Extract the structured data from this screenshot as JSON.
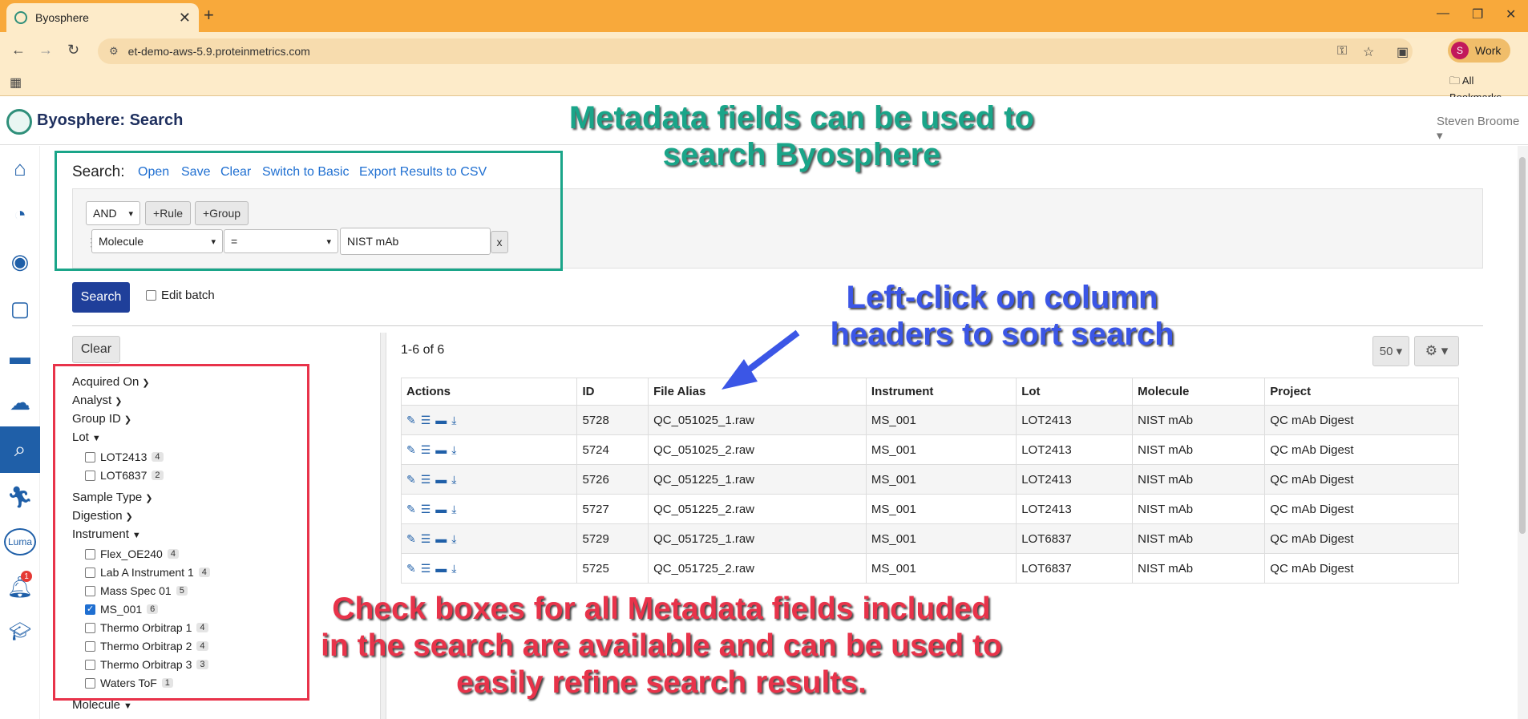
{
  "browser": {
    "tab_title": "Byosphere",
    "url": "et-demo-aws-5.9.proteinmetrics.com",
    "profile_initial": "S",
    "profile_label": "Work",
    "all_bookmarks": "All Bookmarks"
  },
  "app": {
    "title": "Byosphere: Search",
    "user": "Steven Broome"
  },
  "sidebar": {
    "items": [
      "home-icon",
      "dashboard-icon",
      "analytics-icon",
      "byosphere-icon",
      "folder-icon",
      "upload-icon",
      "search-icon",
      "runner-icon",
      "luma-icon",
      "bell-icon",
      "graduation-icon"
    ],
    "luma_label": "Luma",
    "notification_count": "1"
  },
  "search": {
    "label": "Search:",
    "links": [
      "Open",
      "Save",
      "Clear",
      "Switch to Basic",
      "Export Results to CSV"
    ],
    "operator": "AND",
    "add_rule": "+Rule",
    "add_group": "+Group",
    "rule": {
      "field": "Molecule",
      "comparator": "=",
      "value": "NIST mAb",
      "remove": "x"
    },
    "button": "Search",
    "edit_batch": "Edit batch"
  },
  "facets": {
    "clear": "Clear",
    "groups": [
      {
        "label": "Acquired On",
        "expanded": false
      },
      {
        "label": "Analyst",
        "expanded": false
      },
      {
        "label": "Group ID",
        "expanded": false
      },
      {
        "label": "Lot",
        "expanded": true,
        "items": [
          {
            "label": "LOT2413",
            "count": "4",
            "checked": false
          },
          {
            "label": "LOT6837",
            "count": "2",
            "checked": false
          }
        ]
      },
      {
        "label": "Sample Type",
        "expanded": false
      },
      {
        "label": "Digestion",
        "expanded": false
      },
      {
        "label": "Instrument",
        "expanded": true,
        "items": [
          {
            "label": "Flex_OE240",
            "count": "4",
            "checked": false
          },
          {
            "label": "Lab A Instrument 1",
            "count": "4",
            "checked": false
          },
          {
            "label": "Mass Spec 01",
            "count": "5",
            "checked": false
          },
          {
            "label": "MS_001",
            "count": "6",
            "checked": true
          },
          {
            "label": "Thermo Orbitrap 1",
            "count": "4",
            "checked": false
          },
          {
            "label": "Thermo Orbitrap 2",
            "count": "4",
            "checked": false
          },
          {
            "label": "Thermo Orbitrap 3",
            "count": "3",
            "checked": false
          },
          {
            "label": "Waters ToF",
            "count": "1",
            "checked": false
          }
        ]
      },
      {
        "label": "Molecule",
        "expanded": true
      }
    ]
  },
  "results": {
    "count_text": "1-6 of 6",
    "page_size": "50",
    "columns": [
      "Actions",
      "ID",
      "File Alias",
      "Instrument",
      "Lot",
      "Molecule",
      "Project"
    ],
    "rows": [
      [
        "5728",
        "QC_051025_1.raw",
        "MS_001",
        "LOT2413",
        "NIST mAb",
        "QC mAb Digest"
      ],
      [
        "5724",
        "QC_051025_2.raw",
        "MS_001",
        "LOT2413",
        "NIST mAb",
        "QC mAb Digest"
      ],
      [
        "5726",
        "QC_051225_1.raw",
        "MS_001",
        "LOT2413",
        "NIST mAb",
        "QC mAb Digest"
      ],
      [
        "5727",
        "QC_051225_2.raw",
        "MS_001",
        "LOT2413",
        "NIST mAb",
        "QC mAb Digest"
      ],
      [
        "5729",
        "QC_051725_1.raw",
        "MS_001",
        "LOT6837",
        "NIST mAb",
        "QC mAb Digest"
      ],
      [
        "5725",
        "QC_051725_2.raw",
        "MS_001",
        "LOT6837",
        "NIST mAb",
        "QC mAb Digest"
      ]
    ]
  },
  "annotations": {
    "green": "Metadata fields can be used to search Byosphere",
    "blue": "Left-click on column headers to sort search",
    "red": "Check boxes for all Metadata fields included in the search are available and can be used to easily refine search results.",
    "colors": {
      "green": "#1aa589",
      "blue": "#3b56e6",
      "red": "#e8334a"
    }
  }
}
